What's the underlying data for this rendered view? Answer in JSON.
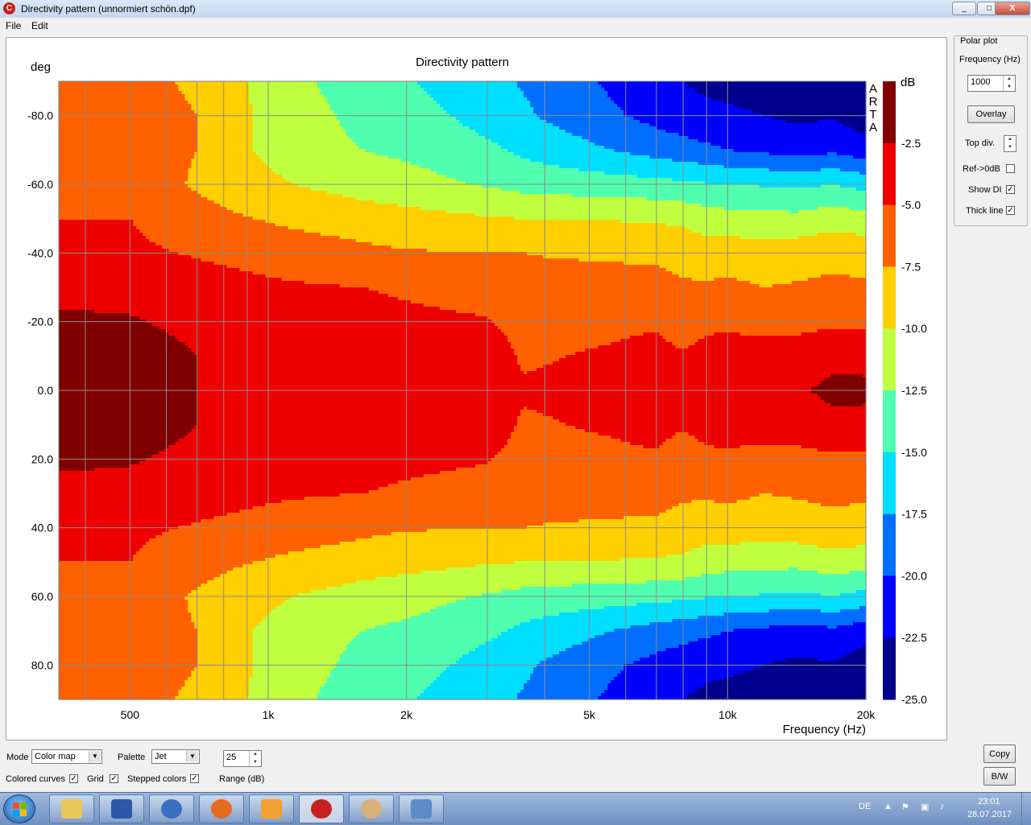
{
  "window": {
    "title": "Directivity pattern (unnormiert schön.dpf)",
    "minimize": "_",
    "maximize": "□",
    "close": "X"
  },
  "menu": {
    "file": "File",
    "edit": "Edit"
  },
  "chart": {
    "title": "Directivity pattern",
    "ylabel": "deg",
    "xlabel": "Frequency (Hz)",
    "colorbar_label": "dB",
    "watermark": [
      "A",
      "R",
      "T",
      "A"
    ],
    "y_ticks": [
      "-80.0",
      "-60.0",
      "-40.0",
      "-20.0",
      "0.0",
      "20.0",
      "40.0",
      "60.0",
      "80.0"
    ],
    "x_ticks": [
      "500",
      "1k",
      "2k",
      "5k",
      "10k",
      "20k"
    ],
    "colorbar_ticks": [
      "-2.5",
      "-5.0",
      "-7.5",
      "-10.0",
      "-12.5",
      "-15.0",
      "-17.5",
      "-20.0",
      "-22.5",
      "-25.0"
    ]
  },
  "chart_data": {
    "type": "heatmap",
    "title": "Directivity pattern",
    "xlabel": "Frequency (Hz)",
    "ylabel": "deg",
    "x_scale": "log",
    "xlim": [
      350,
      20000
    ],
    "ylim": [
      -90,
      90
    ],
    "y_inverted": true,
    "zlim": [
      -25,
      0
    ],
    "z_unit": "dB",
    "z_step": 2.5,
    "palette": "Jet",
    "grid": true,
    "frequencies": [
      350,
      400,
      500,
      600,
      700,
      800,
      900,
      1000,
      1100,
      1200,
      1400,
      1600,
      2000,
      2500,
      3000,
      3300,
      3600,
      4000,
      5000,
      6000,
      7000,
      8000,
      9000,
      10000,
      12000,
      14000,
      17000,
      20000
    ],
    "angles": [
      0,
      10,
      20,
      30,
      40,
      50,
      60,
      70,
      80,
      90
    ],
    "values_db": [
      [
        -0.5,
        -0.5,
        -0.5,
        -1.5,
        -2.5,
        -3.0,
        -3.2,
        -3.3,
        -3.0,
        -3.5,
        -3.8,
        -4.0,
        -4.2,
        -4.3,
        -4.4,
        -4.2,
        -4.6,
        -4.5,
        -4.2,
        -4.0,
        -3.7,
        -3.5,
        -3.4,
        -3.3,
        -3.0,
        -2.8,
        -2.0,
        -2.0
      ],
      [
        -1.0,
        -1.0,
        -1.0,
        -1.8,
        -2.5,
        -3.2,
        -3.4,
        -3.5,
        -3.6,
        -3.8,
        -4.0,
        -4.2,
        -4.4,
        -4.5,
        -4.6,
        -4.5,
        -5.4,
        -5.2,
        -4.8,
        -4.6,
        -4.4,
        -4.8,
        -4.4,
        -4.2,
        -4.0,
        -3.8,
        -3.0,
        -3.2
      ],
      [
        -2.0,
        -2.0,
        -2.2,
        -2.8,
        -3.2,
        -3.6,
        -3.8,
        -4.0,
        -4.1,
        -4.2,
        -4.3,
        -4.5,
        -4.7,
        -4.8,
        -4.9,
        -5.3,
        -6.4,
        -6.3,
        -5.8,
        -5.4,
        -5.2,
        -6.0,
        -5.4,
        -5.3,
        -5.8,
        -5.8,
        -5.5,
        -5.5
      ],
      [
        -3.5,
        -3.6,
        -3.6,
        -3.8,
        -4.0,
        -4.3,
        -4.5,
        -4.6,
        -4.7,
        -4.8,
        -4.9,
        -5.0,
        -5.2,
        -5.4,
        -5.6,
        -6.0,
        -6.7,
        -6.8,
        -6.8,
        -6.8,
        -6.8,
        -7.2,
        -7.2,
        -7.0,
        -7.5,
        -7.3,
        -7.0,
        -7.2
      ],
      [
        -4.5,
        -4.6,
        -4.6,
        -4.9,
        -5.2,
        -5.4,
        -5.6,
        -5.9,
        -6.1,
        -6.3,
        -6.6,
        -6.9,
        -7.3,
        -7.4,
        -7.5,
        -7.5,
        -7.5,
        -7.6,
        -7.7,
        -7.8,
        -7.9,
        -8.3,
        -8.8,
        -8.7,
        -8.8,
        -8.6,
        -8.2,
        -8.5
      ],
      [
        -5.0,
        -5.0,
        -5.0,
        -5.8,
        -6.5,
        -7.0,
        -7.4,
        -7.7,
        -8.0,
        -8.2,
        -8.5,
        -8.8,
        -9.2,
        -9.5,
        -9.8,
        -9.9,
        -10.0,
        -10.0,
        -10.1,
        -10.2,
        -10.3,
        -10.6,
        -11.2,
        -11.5,
        -11.6,
        -11.8,
        -11.0,
        -11.5
      ],
      [
        -6.0,
        -6.0,
        -6.0,
        -7.0,
        -7.8,
        -8.5,
        -9.0,
        -9.5,
        -9.9,
        -10.2,
        -10.6,
        -11.0,
        -11.5,
        -12.2,
        -12.7,
        -13.0,
        -13.3,
        -13.5,
        -13.8,
        -14.0,
        -14.2,
        -14.5,
        -14.8,
        -15.0,
        -15.2,
        -15.5,
        -15.0,
        -15.8
      ],
      [
        -6.5,
        -6.5,
        -6.5,
        -7.0,
        -7.5,
        -8.0,
        -9.8,
        -10.5,
        -11.0,
        -11.5,
        -12.0,
        -12.5,
        -13.0,
        -13.8,
        -14.5,
        -15.0,
        -15.5,
        -16.0,
        -17.0,
        -17.8,
        -18.5,
        -19.0,
        -19.5,
        -20.0,
        -20.5,
        -21.0,
        -20.5,
        -21.5
      ],
      [
        -6.8,
        -6.8,
        -7.0,
        -7.1,
        -7.5,
        -8.2,
        -9.8,
        -10.6,
        -11.2,
        -11.8,
        -12.5,
        -13.2,
        -14.0,
        -15.0,
        -16.0,
        -16.5,
        -17.0,
        -17.8,
        -19.0,
        -20.0,
        -20.8,
        -21.5,
        -22.0,
        -22.2,
        -22.5,
        -23.0,
        -22.8,
        -24.0
      ],
      [
        -7.0,
        -7.0,
        -7.2,
        -7.4,
        -7.8,
        -8.4,
        -10.0,
        -10.8,
        -11.5,
        -12.2,
        -13.0,
        -13.8,
        -14.8,
        -15.8,
        -16.8,
        -17.2,
        -17.8,
        -18.5,
        -19.8,
        -20.8,
        -21.8,
        -22.5,
        -23.0,
        -23.0,
        -23.5,
        -24.0,
        -24.2,
        -25.0
      ]
    ]
  },
  "panel": {
    "group_title": "Polar plot",
    "frequency_label": "Frequency (Hz)",
    "frequency_value": "1000",
    "overlay": "Overlay",
    "top_div": "Top div.",
    "ref_0db": "Ref->0dB",
    "ref_0db_checked": false,
    "show_di": "Show DI",
    "show_di_checked": true,
    "thick_line": "Thick line",
    "thick_line_checked": true
  },
  "bottom": {
    "mode_label": "Mode",
    "mode_value": "Color map",
    "palette_label": "Palette",
    "palette_value": "Jet",
    "range_value": "25",
    "range_label": "Range (dB)",
    "colored_curves": "Colored curves",
    "grid": "Grid",
    "stepped_colors": "Stepped colors",
    "copy": "Copy",
    "bw": "B/W"
  },
  "taskbar": {
    "language": "DE",
    "time": "23:01",
    "date": "28.07.2017"
  },
  "colors": {
    "jet": [
      "#00008f",
      "#0000ff",
      "#006fff",
      "#00dfff",
      "#4fffaf",
      "#bfff3f",
      "#ffcf00",
      "#ff6000",
      "#ef0000",
      "#800000"
    ]
  }
}
